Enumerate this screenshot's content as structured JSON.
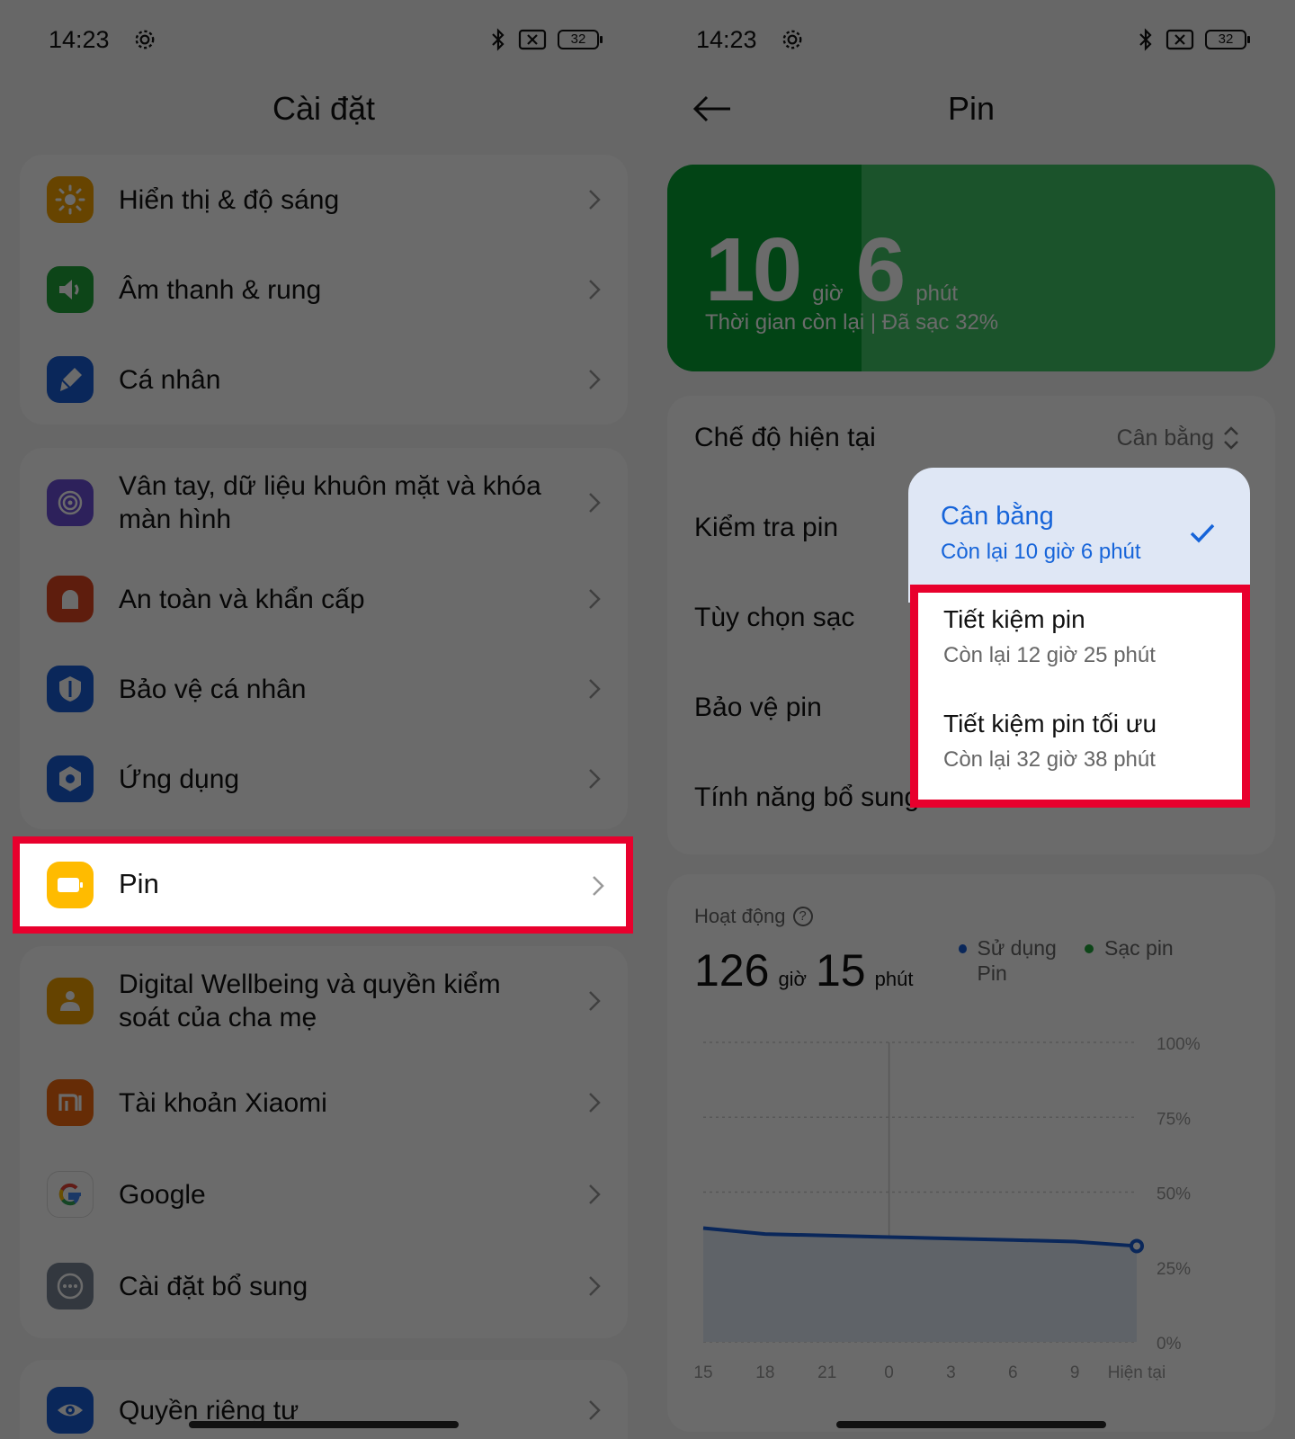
{
  "left": {
    "status": {
      "time": "14:23",
      "battery": "32"
    },
    "title": "Cài đặt",
    "items": [
      {
        "label": "Hiển thị & độ sáng",
        "icon": "sun-icon",
        "color": "#f5a300"
      },
      {
        "label": "Âm thanh & rung",
        "icon": "speaker-icon",
        "color": "#1fa53a"
      },
      {
        "label": "Cá nhân",
        "icon": "brush-icon",
        "color": "#1a5ed6"
      },
      {
        "label": "Vân tay, dữ liệu khuôn mặt và khóa màn hình",
        "icon": "fingerprint-icon",
        "color": "#6b4fd9"
      },
      {
        "label": "An toàn và khẩn cấp",
        "icon": "siren-icon",
        "color": "#e0451f"
      },
      {
        "label": "Bảo vệ cá nhân",
        "icon": "shield-icon",
        "color": "#1a5ed6"
      },
      {
        "label": "Ứng dụng",
        "icon": "apps-gear-icon",
        "color": "#1a5ed6"
      },
      {
        "label": "Pin",
        "icon": "battery-icon",
        "color": "#ffbb00"
      },
      {
        "label": "Digital Wellbeing và quyền kiểm soát của cha mẹ",
        "icon": "wellbeing-icon",
        "color": "#f0a000"
      },
      {
        "label": "Tài khoản Xiaomi",
        "icon": "xiaomi-icon",
        "color": "#f26a10"
      },
      {
        "label": "Google",
        "icon": "google-icon",
        "color": "#ffffff"
      },
      {
        "label": "Cài đặt bổ sung",
        "icon": "more-icon",
        "color": "#7a8696"
      },
      {
        "label": "Quyền riêng tư",
        "icon": "eye-icon",
        "color": "#1a5ed6"
      }
    ]
  },
  "right": {
    "status": {
      "time": "14:23",
      "battery": "32"
    },
    "title": "Pin",
    "battery_card": {
      "hours": "10",
      "hours_unit": "giờ",
      "minutes": "6",
      "minutes_unit": "phút",
      "subtitle": "Thời gian còn lại | Đã sạc 32%",
      "level_percent": 32
    },
    "rows": {
      "mode": "Chế độ hiện tại",
      "mode_value": "Cân bằng",
      "check": "Kiểm tra pin",
      "charge": "Tùy chọn sạc",
      "protect": "Bảo vệ pin",
      "extra": "Tính năng bổ sung"
    },
    "dropdown": {
      "selected": {
        "title": "Cân bằng",
        "sub": "Còn lại 10 giờ 6 phút"
      },
      "options": [
        {
          "title": "Tiết kiệm pin",
          "sub": "Còn lại 12 giờ 25 phút"
        },
        {
          "title": "Tiết kiệm pin tối ưu",
          "sub": "Còn lại 32 giờ 38 phút"
        }
      ]
    },
    "activity": {
      "title": "Hoạt động",
      "help": "?",
      "hours": "126",
      "hours_unit": "giờ",
      "minutes": "15",
      "minutes_unit": "phút",
      "legend_usage": "Sử dụng Pin",
      "legend_charge": "Sạc pin",
      "usage_color": "#1a5ed6",
      "charge_color": "#1fa53a"
    }
  },
  "chart_data": {
    "type": "line",
    "x": [
      "15",
      "18",
      "21",
      "0",
      "3",
      "6",
      "9",
      "Hiện tại"
    ],
    "series": [
      {
        "values": [
          38,
          36,
          35.5,
          35,
          34.5,
          34,
          33.5,
          32
        ]
      }
    ],
    "y_ticks": [
      "100%",
      "75%",
      "50%",
      "25%",
      "0%"
    ],
    "ylim": [
      0,
      100
    ],
    "grid": true
  }
}
